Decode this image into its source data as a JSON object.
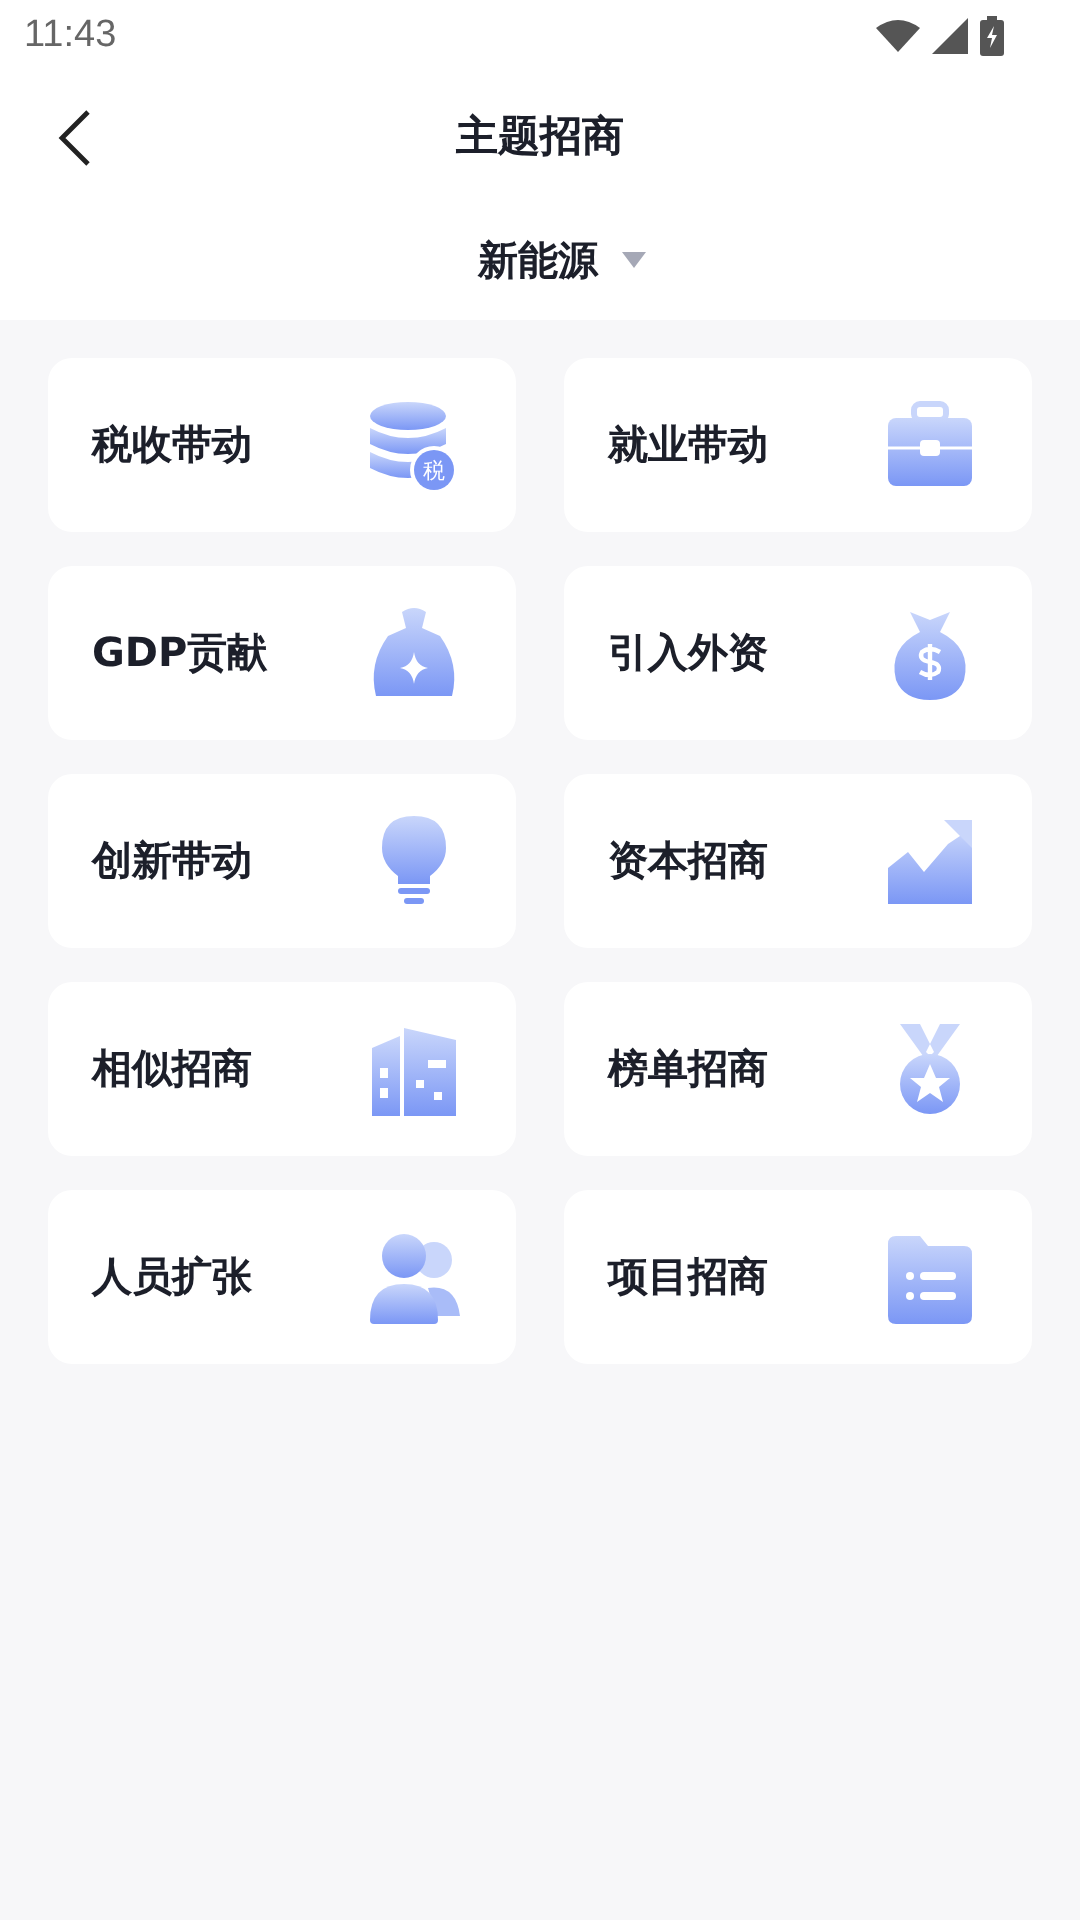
{
  "status_bar": {
    "time": "11:43"
  },
  "header": {
    "title": "主题招商"
  },
  "filter": {
    "label": "新能源"
  },
  "cards": [
    {
      "label": "税收带动",
      "kind": "coins",
      "badge": "税"
    },
    {
      "label": "就业带动",
      "kind": "briefcase"
    },
    {
      "label": "GDP贡献",
      "kind": "bag"
    },
    {
      "label": "引入外资",
      "kind": "dollar"
    },
    {
      "label": "创新带动",
      "kind": "bulb"
    },
    {
      "label": "资本招商",
      "kind": "trend"
    },
    {
      "label": "相似招商",
      "kind": "building"
    },
    {
      "label": "榜单招商",
      "kind": "medal"
    },
    {
      "label": "人员扩张",
      "kind": "people"
    },
    {
      "label": "项目招商",
      "kind": "folder"
    }
  ]
}
